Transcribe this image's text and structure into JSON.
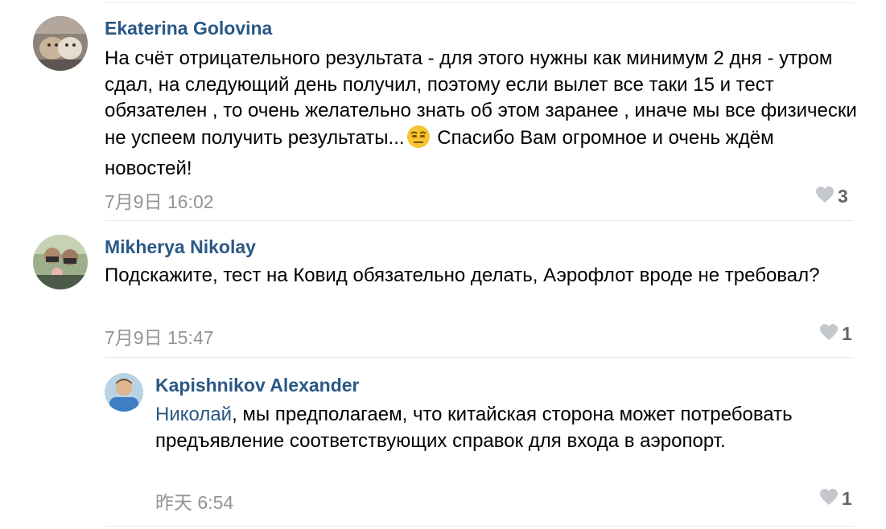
{
  "comments": [
    {
      "author": "Ekaterina Golovina",
      "text_before_emoji": "На счёт отрицательного результата - для этого нужны как минимум 2 дня - утром сдал, на следующий день получил, поэтому если вылет все таки 15 и тест обязателен , то очень желательно знать об этом заранее , иначе мы все физически не успеем получить результаты...",
      "text_after_emoji": " Спасибо Вам огромное и очень ждём новостей!",
      "emoji": "worried-face-emoji",
      "date": "7月9日 16:02",
      "likes": "3"
    },
    {
      "author": "Mikherya Nikolay",
      "text": "Подскажите, тест на Ковид обязательно делать, Аэрофлот вроде не требовал?",
      "date": "7月9日 15:47",
      "likes": "1"
    },
    {
      "author": "Kapishnikov Alexander",
      "mention": "Николай",
      "text": ", мы предполагаем, что китайская сторона может потребовать предъявление соответствующих справок для входа в аэропорт.",
      "date": "昨天 6:54",
      "likes": "1"
    }
  ],
  "colors": {
    "author": "#2a5885",
    "meta": "#939393",
    "like_icon": "#c4c8cc",
    "like_count": "#656565",
    "divider": "#e7e8ec"
  },
  "icons": {
    "like": "heart-icon"
  }
}
